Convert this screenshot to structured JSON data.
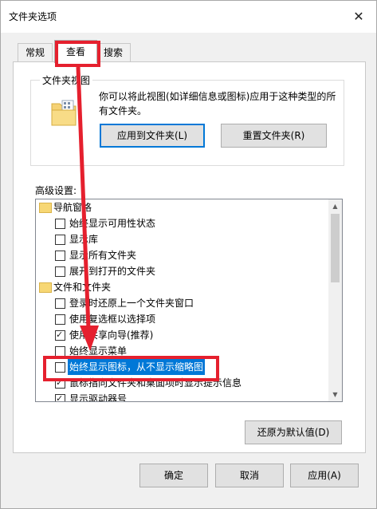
{
  "window": {
    "title": "文件夹选项",
    "close_glyph": "✕"
  },
  "tabs": [
    {
      "label": "常规"
    },
    {
      "label": "查看"
    },
    {
      "label": "搜索"
    }
  ],
  "folder_views": {
    "legend": "文件夹视图",
    "description": "你可以将此视图(如详细信息或图标)应用于这种类型的所有文件夹。",
    "apply_button": "应用到文件夹(L)",
    "reset_button": "重置文件夹(R)"
  },
  "advanced": {
    "label": "高级设置:",
    "items": [
      {
        "type": "folder",
        "label": "导航窗格",
        "indent": 0
      },
      {
        "type": "checkbox",
        "label": "始终显示可用性状态",
        "checked": false,
        "indent": 1
      },
      {
        "type": "checkbox",
        "label": "显示库",
        "checked": false,
        "indent": 1
      },
      {
        "type": "checkbox",
        "label": "显示所有文件夹",
        "checked": false,
        "indent": 1
      },
      {
        "type": "checkbox",
        "label": "展开到打开的文件夹",
        "checked": false,
        "indent": 1
      },
      {
        "type": "folder",
        "label": "文件和文件夹",
        "indent": 0
      },
      {
        "type": "checkbox",
        "label": "登录时还原上一个文件夹窗口",
        "checked": false,
        "indent": 1
      },
      {
        "type": "checkbox",
        "label": "使用复选框以选择项",
        "checked": false,
        "indent": 1
      },
      {
        "type": "checkbox",
        "label": "使用共享向导(推荐)",
        "checked": true,
        "indent": 1
      },
      {
        "type": "checkbox",
        "label": "始终显示菜单",
        "checked": false,
        "indent": 1
      },
      {
        "type": "checkbox",
        "label": "始终显示图标，从不显示缩略图",
        "checked": false,
        "indent": 1,
        "selected": true
      },
      {
        "type": "checkbox",
        "label": "鼠标指向文件夹和桌面项时显示提示信息",
        "checked": true,
        "indent": 1
      },
      {
        "type": "checkbox",
        "label": "显示驱动器号",
        "checked": true,
        "indent": 1
      }
    ],
    "restore_button": "还原为默认值(D)"
  },
  "footer": {
    "ok": "确定",
    "cancel": "取消",
    "apply": "应用(A)"
  },
  "colors": {
    "highlight": "#0078d7",
    "annotation": "#e5202e"
  }
}
